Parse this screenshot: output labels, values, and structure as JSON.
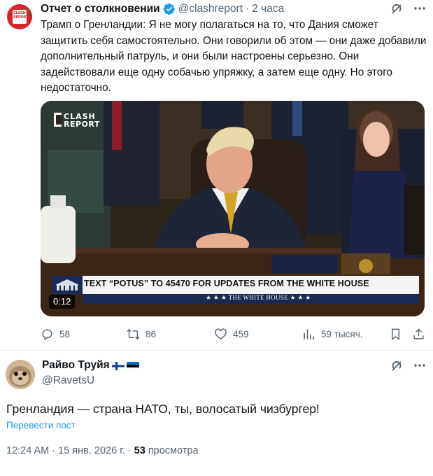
{
  "quoted_post": {
    "author_name": "Отчет о столкновении",
    "handle": "@clashreport",
    "separator": "·",
    "time": "2 часа",
    "avatar_text": "CLASH\nREPORT",
    "text": "Трамп о Гренландии: Я не могу полагаться на то, что Дания сможет защитить себя самостоятельно. Они говорили об этом — они даже добавили дополнительный патруль, и они были настроены серьезно. Они задействовали еще одну собачью упряжку, а затем еще одну. Но этого недостаточно.",
    "video": {
      "watermark_line1": "CLASH",
      "watermark_line2": "REPORT",
      "ticker_text": "TEXT “POTUS” TO 45470 FOR UPDATES FROM THE WHITE HOUSE",
      "ticker_sub": "★ ★ ★   THE WHITE HOUSE   ★ ★ ★",
      "duration": "0:12"
    },
    "actions": {
      "replies": "58",
      "reposts": "86",
      "likes": "459",
      "views": "59 тысяч."
    }
  },
  "reply": {
    "author_name": "Райво Труйя",
    "handle": "@RavetsU",
    "text": "Гренландия — страна НАТО, ты, волосатый чизбургер!",
    "translate_link": "Перевести пост",
    "timestamp": "12:24 AM · 15 янв. 2026 г. · ",
    "views_count": "53",
    "views_label": " просмотра"
  },
  "colors": {
    "accent": "#1d9bf0",
    "secondary_text": "#536471",
    "primary_text": "#0f1419",
    "brand_red": "#d8232a"
  },
  "icons": [
    "verified-badge-icon",
    "grok-icon",
    "more-icon",
    "reply-icon",
    "repost-icon",
    "like-icon",
    "views-icon",
    "bookmark-icon",
    "share-icon",
    "finland-flag-icon",
    "estonia-flag-icon"
  ]
}
